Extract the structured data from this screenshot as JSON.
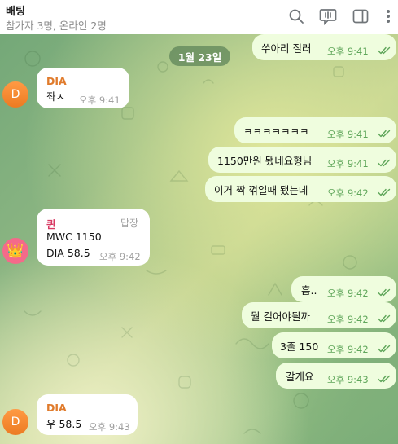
{
  "header": {
    "title": "배팅",
    "status": "참가자 3명, 온라인 2명",
    "icons": [
      "search-icon",
      "live-stream-icon",
      "sidebar-toggle-icon",
      "more-icon"
    ]
  },
  "date_separator": "1월 23일",
  "messages": [
    {
      "direction": "out",
      "text": "쑤아리 질러",
      "time": "오후 9:41",
      "read": true
    },
    {
      "direction": "in",
      "sender": "DIA",
      "avatar_letter": "D",
      "text": "좌ㅅ",
      "time": "오후 9:41"
    },
    {
      "direction": "out",
      "text": "ㅋㅋㅋㅋㅋㅋㅋ",
      "time": "오후 9:41",
      "read": true
    },
    {
      "direction": "out",
      "text": "1150만원 됐네요형님",
      "time": "오후 9:41",
      "read": true
    },
    {
      "direction": "out",
      "text": "이거 짝 꺾일때 됐는데",
      "time": "오후 9:42",
      "read": true
    },
    {
      "direction": "in",
      "sender": "퀸",
      "avatar_emoji": "👑",
      "reply_label": "답장",
      "lines": [
        "MWC  1150",
        "DIA  58.5"
      ],
      "time": "오후 9:42"
    },
    {
      "direction": "out",
      "text": "흠..",
      "time": "오후 9:42",
      "read": true
    },
    {
      "direction": "out",
      "text": "뭘 걸어야될까",
      "time": "오후 9:42",
      "read": true
    },
    {
      "direction": "out",
      "text": "3줄 150",
      "time": "오후 9:42",
      "read": true
    },
    {
      "direction": "out",
      "text": "갈게요",
      "time": "오후 9:43",
      "read": true
    },
    {
      "direction": "in",
      "sender": "DIA",
      "avatar_letter": "D",
      "text": "우 58.5",
      "time": "오후 9:43"
    }
  ],
  "colors": {
    "dia_sender": "#e07b2c",
    "queen_sender": "#d83a63",
    "outgoing_bubble": "#effdde",
    "read_ticks": "#5fa65a"
  }
}
